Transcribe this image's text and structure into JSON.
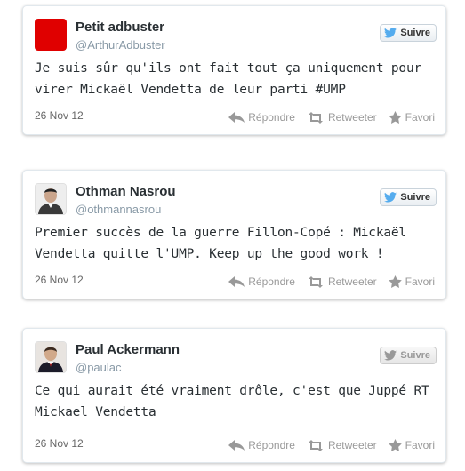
{
  "tweets": [
    {
      "name": "Petit adbuster",
      "handle": "@ArthurAdbuster",
      "text": "Je suis sûr qu'ils ont fait tout ça uniquement pour virer Mickaël Vendetta de leur parti #UMP",
      "date": "26 Nov 12",
      "follow_label": "Suivre",
      "reply_label": "Répondre",
      "retweet_label": "Retweeter",
      "favorite_label": "Favori",
      "avatar": "red-square-avatar"
    },
    {
      "name": "Othman Nasrou",
      "handle": "@othmannasrou",
      "text": "Premier succès de la guerre Fillon-Copé : Mickaël Vendetta quitte l'UMP. Keep up the good work !",
      "date": "26 Nov 12",
      "follow_label": "Suivre",
      "reply_label": "Répondre",
      "retweet_label": "Retweeter",
      "favorite_label": "Favori",
      "avatar": "portrait-photo-avatar"
    },
    {
      "name": "Paul Ackermann",
      "handle": "@paulac",
      "text": "Ce qui aurait été vraiment drôle, c'est que Juppé RT Mickael Vendetta",
      "date": "26 Nov 12",
      "follow_label": "Suivre",
      "reply_label": "Répondre",
      "retweet_label": "Retweeter",
      "favorite_label": "Favori",
      "avatar": "portrait-photo-avatar"
    }
  ],
  "colors": {
    "twitter_blue": "#55acee",
    "action_gray": "#999999",
    "red_avatar": "#e00000"
  }
}
